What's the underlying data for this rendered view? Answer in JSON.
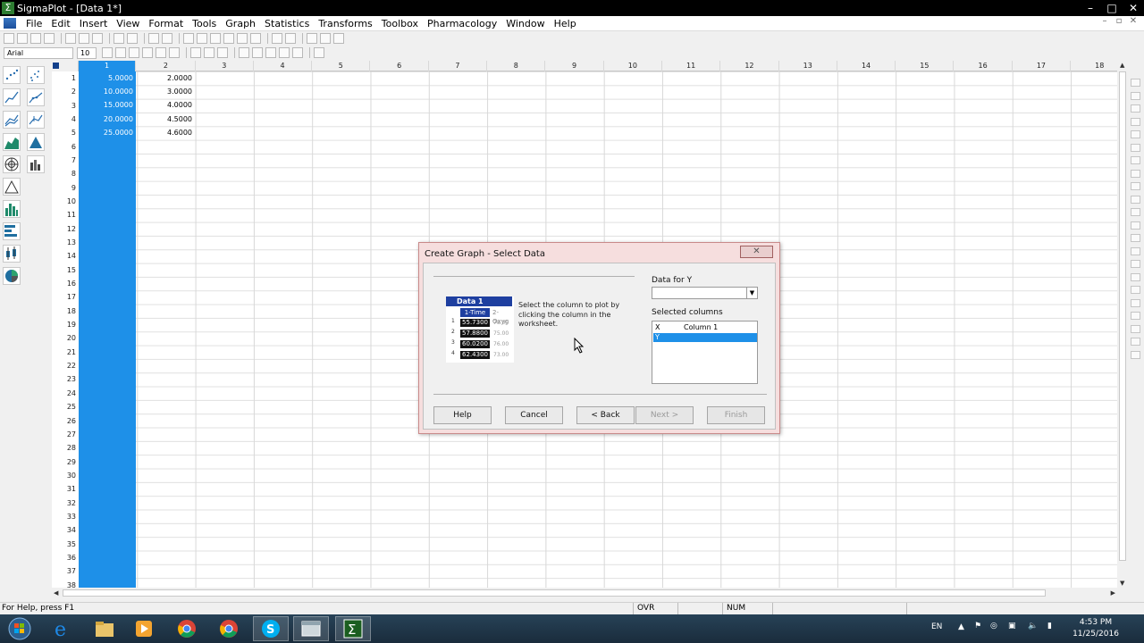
{
  "window": {
    "title": "SigmaPlot - [Data 1*]",
    "app_icon": "sigma-icon",
    "controls": [
      "minimize-icon",
      "maximize-icon",
      "close-icon"
    ]
  },
  "menu": {
    "items": [
      "File",
      "Edit",
      "Insert",
      "View",
      "Format",
      "Tools",
      "Graph",
      "Statistics",
      "Transforms",
      "Toolbox",
      "Pharmacology",
      "Window",
      "Help"
    ]
  },
  "format_toolbar": {
    "font": "Arial",
    "size": "10"
  },
  "worksheet": {
    "columns": [
      "1",
      "2",
      "3",
      "4",
      "5",
      "6",
      "7",
      "8",
      "9",
      "10",
      "11",
      "12",
      "13",
      "14",
      "15",
      "16",
      "17",
      "18"
    ],
    "rows": [
      "1",
      "2",
      "3",
      "4",
      "5",
      "6",
      "7",
      "8",
      "9",
      "10",
      "11",
      "12",
      "13",
      "14",
      "15",
      "16",
      "17",
      "18",
      "19",
      "20",
      "21",
      "22",
      "23",
      "24",
      "25",
      "26",
      "27",
      "28",
      "29",
      "30",
      "31",
      "32",
      "33",
      "34",
      "35",
      "36",
      "37",
      "38"
    ],
    "col1": [
      "5.0000",
      "10.0000",
      "15.0000",
      "20.0000",
      "25.0000"
    ],
    "col2": [
      "2.0000",
      "3.0000",
      "4.0000",
      "4.5000",
      "4.6000"
    ],
    "selected_column": "1",
    "selection_color": "#1e90e8"
  },
  "dialog": {
    "title": "Create Graph - Select Data",
    "close_icon": "close-icon",
    "preview": {
      "title": "Data 1",
      "col_header": "1-Time",
      "col_header2": "2-Oxyg",
      "row_numbers": [
        "1",
        "2",
        "3",
        "4"
      ],
      "col1": [
        "55.7300",
        "57.8800",
        "60.0200",
        "62.4300"
      ],
      "col2": [
        "78.00",
        "75.00",
        "76.00",
        "73.00"
      ]
    },
    "instruction": "Select the column to plot by clicking the column in the worksheet.",
    "data_for_label": "Data for Y",
    "data_for_value": "",
    "selected_columns_label": "Selected columns",
    "selected_columns": [
      {
        "key": "X",
        "value": "Column 1"
      },
      {
        "key": "Y",
        "value": ""
      }
    ],
    "buttons": {
      "help": "Help",
      "cancel": "Cancel",
      "back": "< Back",
      "next": "Next >",
      "finish": "Finish"
    }
  },
  "statusbar": {
    "help_text": "For Help, press F1",
    "ovr": "OVR",
    "num": "NUM"
  },
  "taskbar": {
    "apps": [
      "windows-start-icon",
      "internet-explorer-icon",
      "file-explorer-icon",
      "media-player-icon",
      "chrome-icon",
      "chrome-icon",
      "skype-icon",
      "window-app-icon",
      "sigmaplot-icon"
    ],
    "language": "EN",
    "time": "4:53 PM",
    "date": "11/25/2016"
  }
}
